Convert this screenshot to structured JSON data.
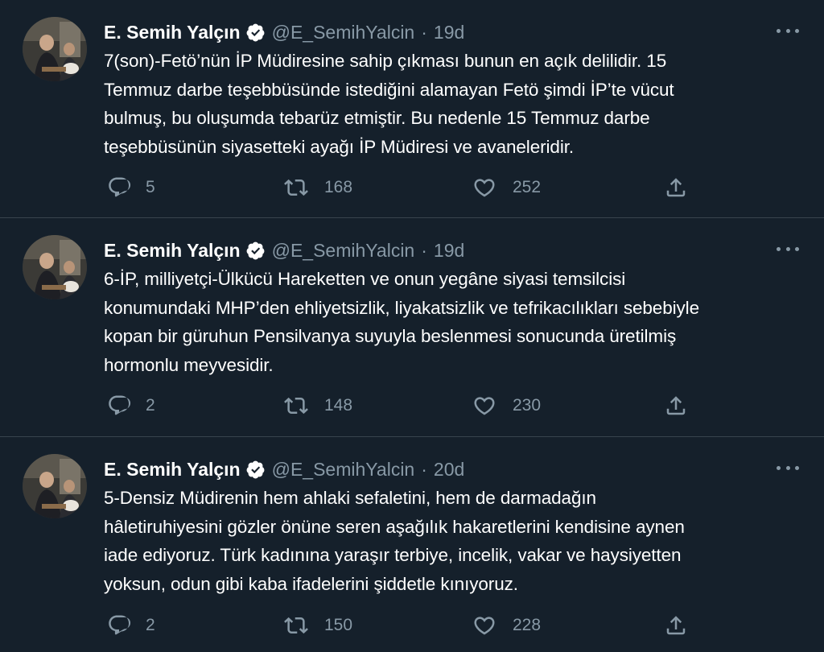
{
  "tweets": [
    {
      "author_name": "E. Semih Yalçın",
      "handle": "@E_SemihYalcin",
      "separator": "·",
      "time": "19d",
      "text_lines": [
        "7(son)-Fetö’nün İP Müdiresine sahip çıkması bunun en açık delilidir. 15",
        "Temmuz darbe teşebbüsünde istediğini alamayan Fetö şimdi İP’te vücut",
        "bulmuş, bu oluşumda tebarüz etmiştir. Bu nedenle 15 Temmuz darbe",
        "teşebbüsünün siyasetteki ayağı İP Müdiresi ve avaneleridir."
      ],
      "replies": "5",
      "retweets": "168",
      "likes": "252"
    },
    {
      "author_name": "E. Semih Yalçın",
      "handle": "@E_SemihYalcin",
      "separator": "·",
      "time": "19d",
      "text_lines": [
        "6-İP, milliyetçi-Ülkücü Hareketten ve onun yegâne siyasi temsilcisi",
        "konumundaki MHP’den ehliyetsizlik, liyakatsizlik ve tefrikacılıkları sebebiyle",
        "kopan bir güruhun Pensilvanya suyuyla beslenmesi sonucunda üretilmiş",
        "hormonlu meyvesidir."
      ],
      "replies": "2",
      "retweets": "148",
      "likes": "230"
    },
    {
      "author_name": "E. Semih Yalçın",
      "handle": "@E_SemihYalcin",
      "separator": "·",
      "time": "20d",
      "text_lines": [
        "5-Densiz Müdirenin hem ahlaki sefaletini, hem de darmadağın",
        "hâletiruhiyesini gözler önüne seren aşağılık hakaretlerini kendisine aynen",
        "iade ediyoruz. Türk kadınına yaraşır terbiye, incelik, vakar ve haysiyetten",
        "yoksun, odun gibi kaba ifadelerini şiddetle kınıyoruz."
      ],
      "replies": "2",
      "retweets": "150",
      "likes": "228"
    }
  ],
  "icons": {
    "verified": "verified-badge-icon",
    "more": "more-options-icon",
    "reply": "reply-icon",
    "retweet": "retweet-icon",
    "like": "like-icon",
    "share": "share-icon"
  },
  "colors": {
    "background": "#15202b",
    "divider": "#38444d",
    "primary_text": "#ffffff",
    "secondary_text": "#8899a6"
  }
}
